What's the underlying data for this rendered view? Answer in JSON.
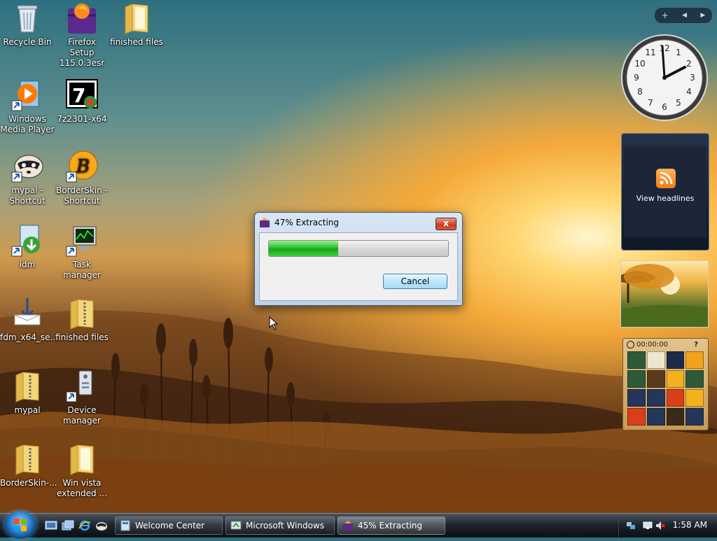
{
  "desktop": {
    "icons": [
      {
        "label": "Recycle Bin",
        "icon": "recycle-bin-icon"
      },
      {
        "label": "Firefox Setup 115.0.3esr",
        "icon": "firefox-setup-icon"
      },
      {
        "label": "finished files",
        "icon": "folder-icon"
      },
      {
        "label": "Windows Media Player",
        "icon": "media-player-icon"
      },
      {
        "label": "7z2301-x64",
        "icon": "7zip-icon"
      },
      {
        "label": "mypal - Shortcut",
        "icon": "mypal-icon"
      },
      {
        "label": "BorderSkin - Shortcut",
        "icon": "borderskin-icon"
      },
      {
        "label": "idm",
        "icon": "idm-icon"
      },
      {
        "label": "Task manager",
        "icon": "task-manager-icon"
      },
      {
        "label": "fdm_x64_se...",
        "icon": "installer-icon"
      },
      {
        "label": "finished files",
        "icon": "zip-folder-icon"
      },
      {
        "label": "mypal",
        "icon": "zip-folder-icon"
      },
      {
        "label": "Device manager",
        "icon": "device-manager-icon"
      },
      {
        "label": "BorderSkin-...",
        "icon": "zip-folder-icon"
      },
      {
        "label": "Win vista extended ...",
        "icon": "folder-icon"
      }
    ]
  },
  "dialog": {
    "title": "47% Extracting",
    "progress_percent": 47,
    "cancel_label": "Cancel",
    "close_label": "x"
  },
  "sidebar": {
    "add_label": "+",
    "prev_label": "◀",
    "next_label": "▶",
    "feed_label": "View headlines",
    "puzzle_time": "00:00:00",
    "puzzle_help": "?"
  },
  "taskbar": {
    "tasks": [
      {
        "label": "Welcome Center"
      },
      {
        "label": "Microsoft Windows"
      },
      {
        "label": "45% Extracting"
      }
    ],
    "time": "1:58 AM"
  }
}
